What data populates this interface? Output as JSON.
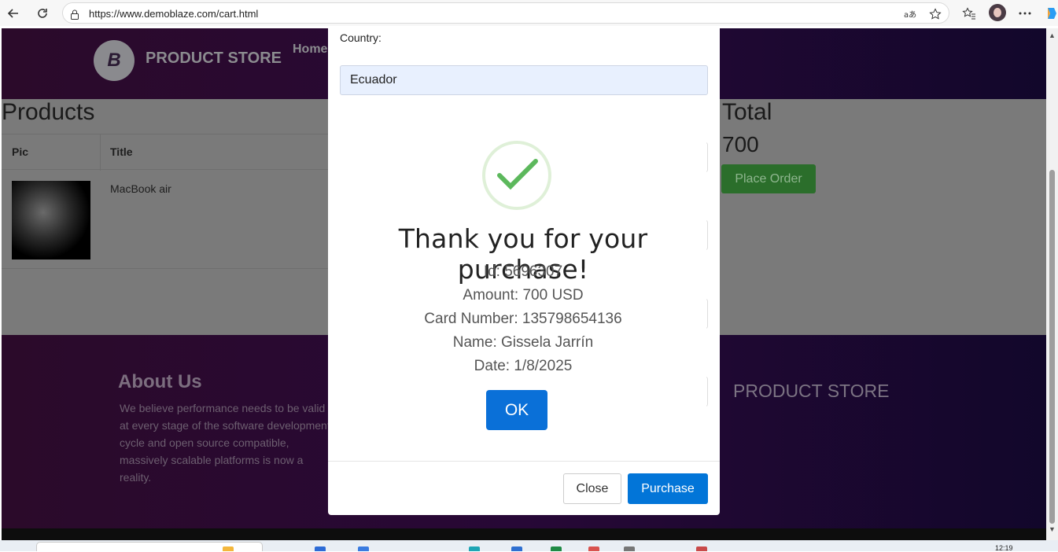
{
  "browser": {
    "url": "https://www.demoblaze.com/cart.html"
  },
  "site": {
    "brand": "PRODUCT STORE",
    "logo_letter": "B",
    "nav_home": "Home"
  },
  "cart": {
    "products_title": "Products",
    "columns": [
      "Pic",
      "Title"
    ],
    "rows": [
      {
        "title": "MacBook air"
      }
    ],
    "total_title": "Total",
    "total_value": "700",
    "place_order_label": "Place Order"
  },
  "footer": {
    "about_title": "About Us",
    "about_text": "We believe performance needs to be valid at every stage of the software development cycle and open source compatible, massively scalable platforms is now a reality.",
    "brand": "PRODUCT STORE"
  },
  "order_modal": {
    "country_label": "Country:",
    "country_value": "Ecuador",
    "close_label": "Close",
    "purchase_label": "Purchase"
  },
  "confirmation": {
    "title": "Thank you for your purchase!",
    "id_line": "Id: 5696307",
    "amount_line": "Amount: 700 USD",
    "card_line": "Card Number: 135798654136",
    "name_line": "Name: Gissela Jarrín",
    "date_line": "Date: 1/8/2025",
    "ok_label": "OK"
  },
  "taskbar": {
    "clock": "12:19"
  },
  "colors": {
    "accent_blue": "#0275d8",
    "success_green": "#5cb85c"
  }
}
